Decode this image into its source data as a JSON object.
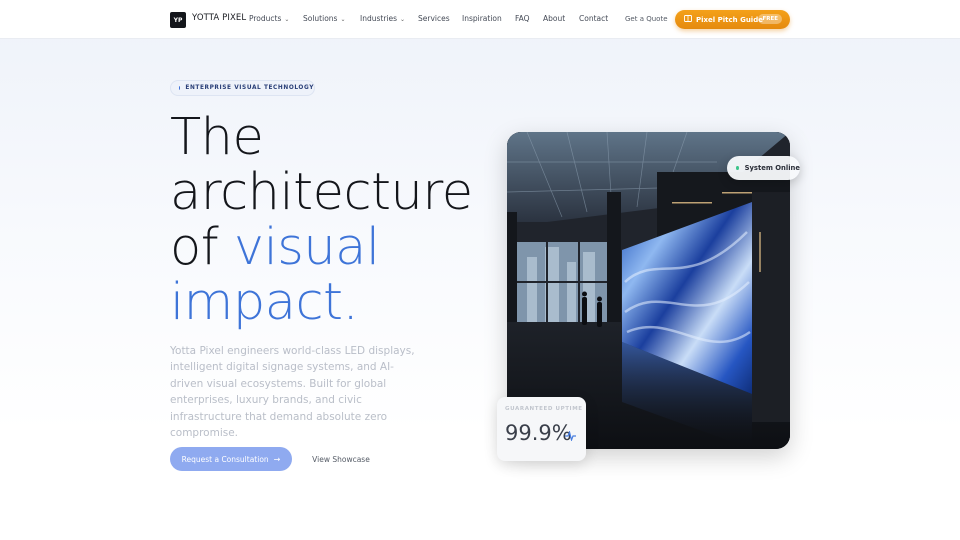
{
  "brand": {
    "logo_mark": "YP",
    "name": "YOTTA PIXEL"
  },
  "nav": {
    "items": [
      {
        "label": "Products",
        "dropdown": true
      },
      {
        "label": "Solutions",
        "dropdown": true
      },
      {
        "label": "Industries",
        "dropdown": true
      },
      {
        "label": "Services",
        "dropdown": false
      },
      {
        "label": "Inspiration",
        "dropdown": false
      },
      {
        "label": "FAQ",
        "dropdown": false
      },
      {
        "label": "About",
        "dropdown": false
      },
      {
        "label": "Contact",
        "dropdown": false
      }
    ],
    "quote_label": "Get a Quote",
    "guide_label": "Pixel Pitch Guide",
    "guide_badge": "FREE",
    "guide_icon": "book-icon"
  },
  "hero": {
    "eyebrow": "ENTERPRISE VISUAL TECHNOLOGY",
    "headline_line1": "The",
    "headline_line2": "architecture",
    "headline_line3_plain": "of",
    "headline_line3_accent": "visual",
    "headline_line4": "impact.",
    "intro": "Yotta Pixel engineers world-class LED displays, intelligent digital signage systems, and AI-driven visual ecosystems. Built for global enterprises, luxury brands, and civic infrastructure that demand absolute zero compromise.",
    "primary_cta": "Request a Consultation",
    "secondary_cta": "View Showcase",
    "status_text": "System Online",
    "uptime_label": "GUARANTEED UPTIME",
    "uptime_value": "99.9%"
  },
  "colors": {
    "accent_blue": "#3e74d8",
    "guide_orange": "#f29a16",
    "status_green": "#3cc48a",
    "cta_blue": "#8faaf0"
  }
}
